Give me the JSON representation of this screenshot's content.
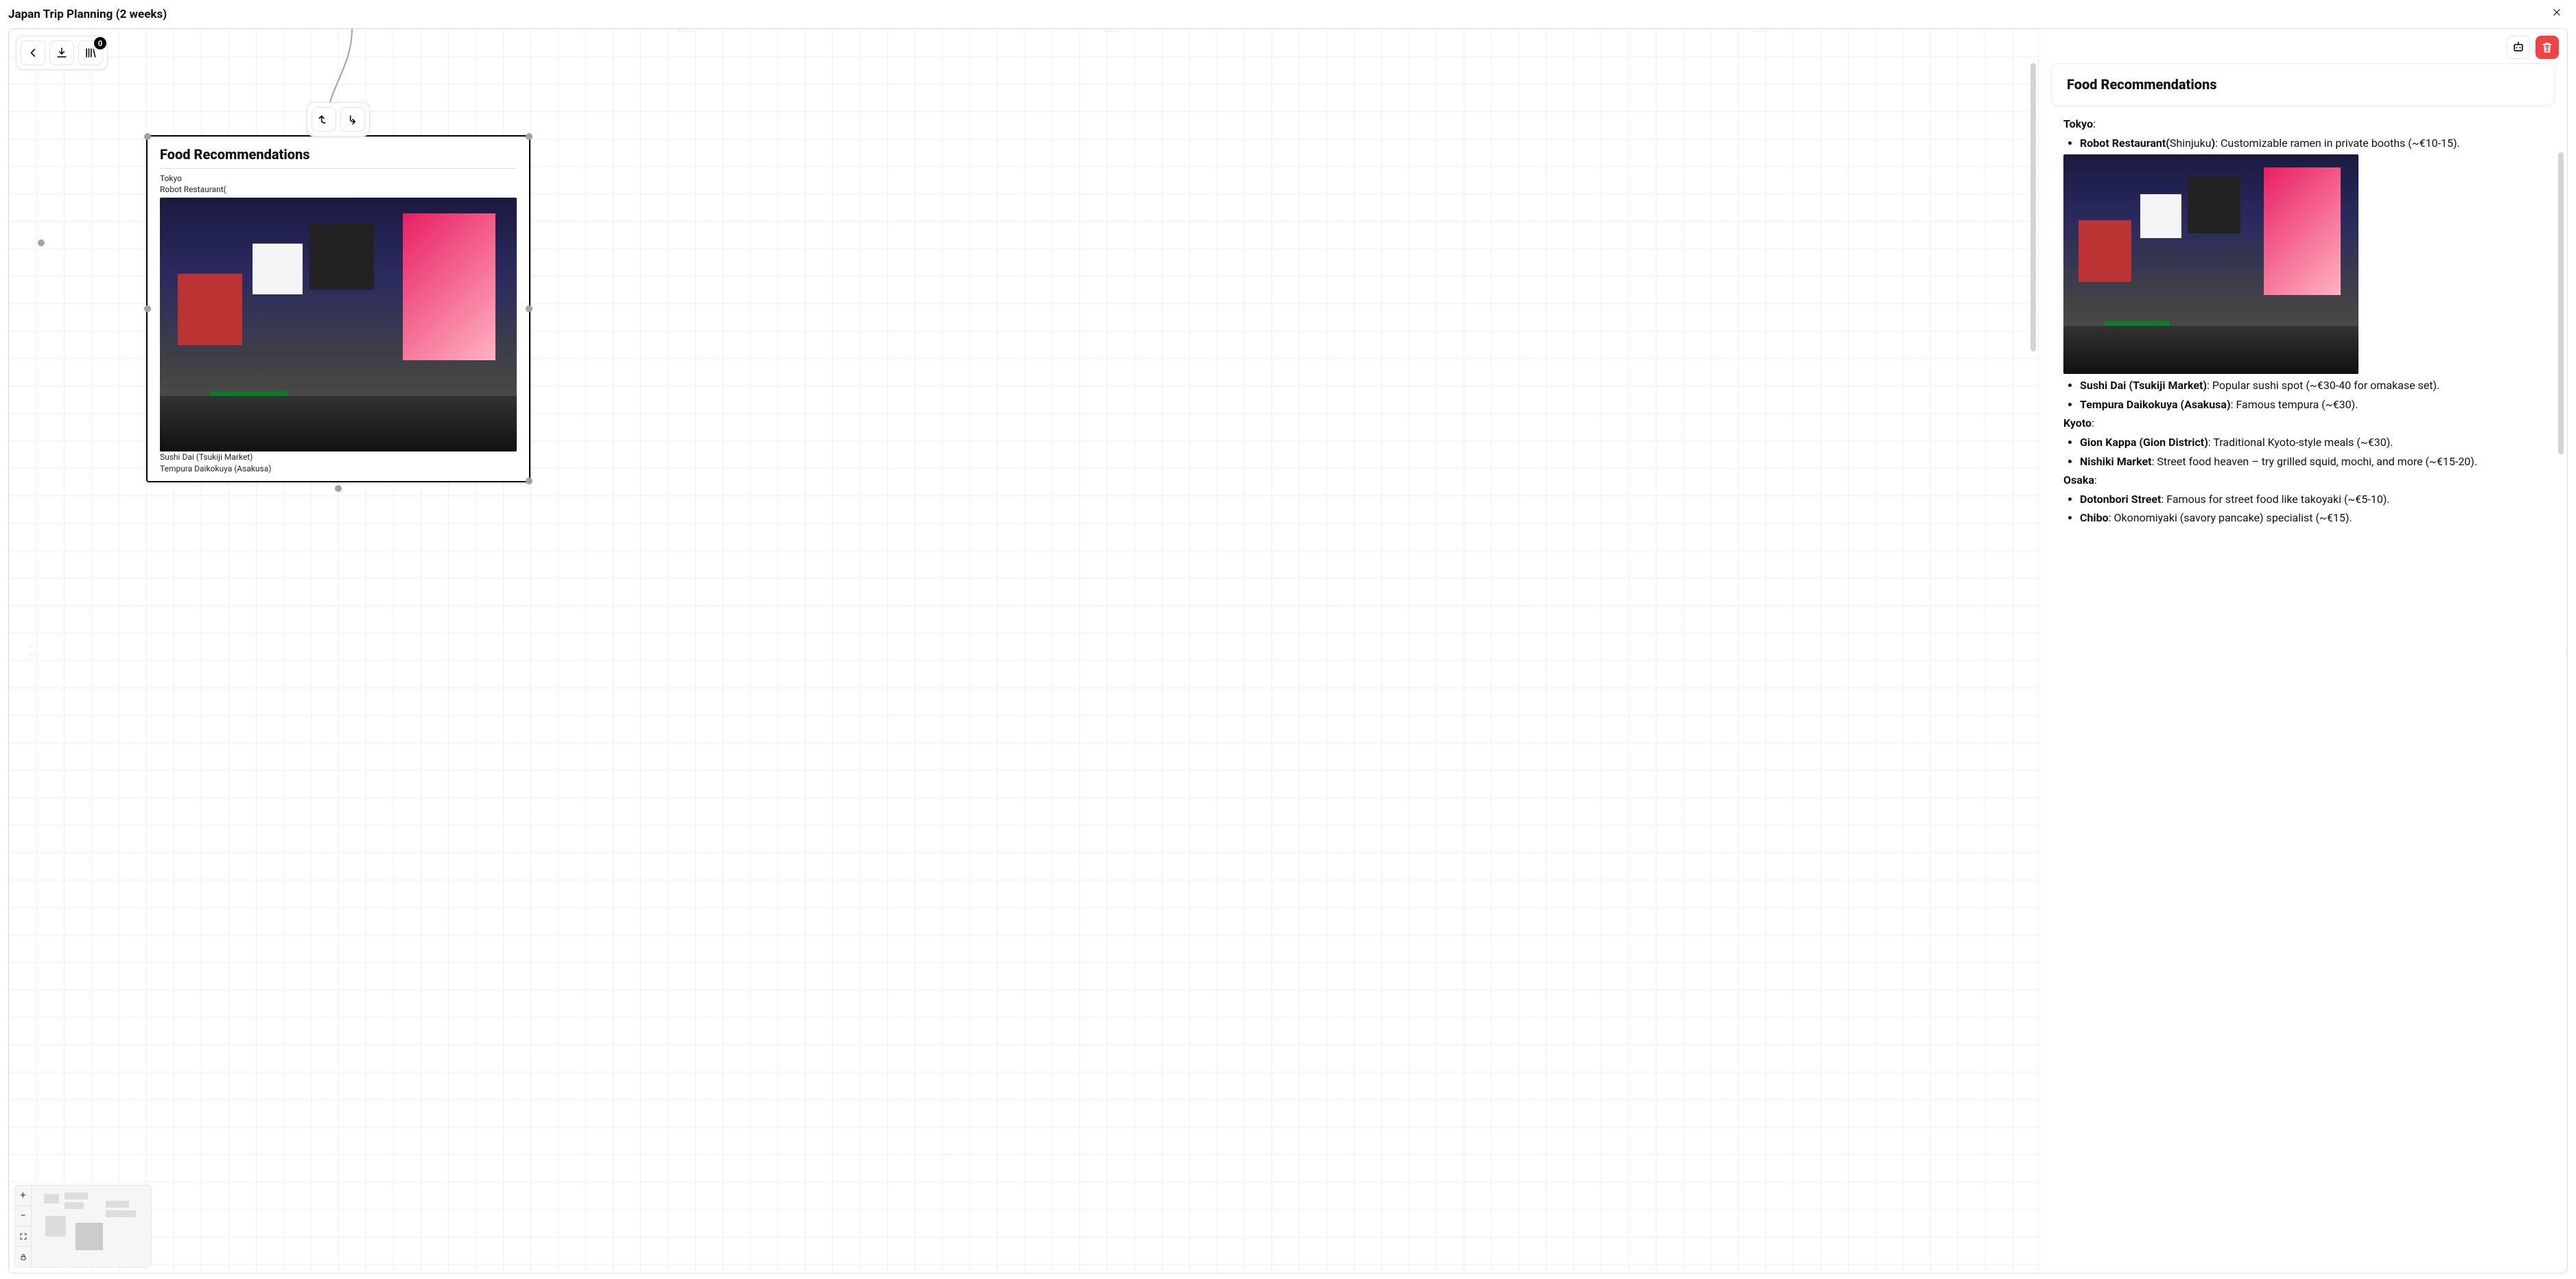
{
  "title": "Japan Trip Planning (2 weeks)",
  "toolbar": {
    "badge_count": "0"
  },
  "node": {
    "title": "Food Recommendations",
    "lines": {
      "l1": "Tokyo",
      "l2": "Robot Restaurant(",
      "l3": "Sushi Dai (Tsukiji Market)",
      "l4": "Tempura Daikokuya (Asakusa)"
    }
  },
  "detail": {
    "title": "Food Recommendations",
    "tokyo": {
      "label": "Tokyo",
      "colon": ":",
      "robot": {
        "place": "Robot Restaurant(",
        "inner": "Shinjuku",
        "close": ")",
        "desc": ":  Customizable ramen in private booths (~€10-15)."
      },
      "sushidai": {
        "place": "Sushi Dai (Tsukiji Market)",
        "desc": ": Popular sushi spot (~€30-40 for omakase set)."
      },
      "tempura": {
        "place": "Tempura Daikokuya (Asakusa)",
        "desc": ": Famous tempura (~€30)."
      }
    },
    "kyoto": {
      "label": "Kyoto",
      "colon": ":",
      "gion": {
        "place": "Gion Kappa (Gion District)",
        "desc": ": Traditional Kyoto-style meals (~€30)."
      },
      "nishiki": {
        "place": "Nishiki Market",
        "desc": ": Street food heaven – try grilled squid, mochi, and more (~€15-20)."
      }
    },
    "osaka": {
      "label": "Osaka",
      "colon": ":",
      "dotonbori": {
        "place": "Dotonbori Street",
        "desc": ": Famous for street food like takoyaki (~€5-10)."
      },
      "chibo": {
        "place": "Chibo",
        "desc": ": Okonomiyaki (savory pancake) specialist (~€15)."
      }
    }
  }
}
